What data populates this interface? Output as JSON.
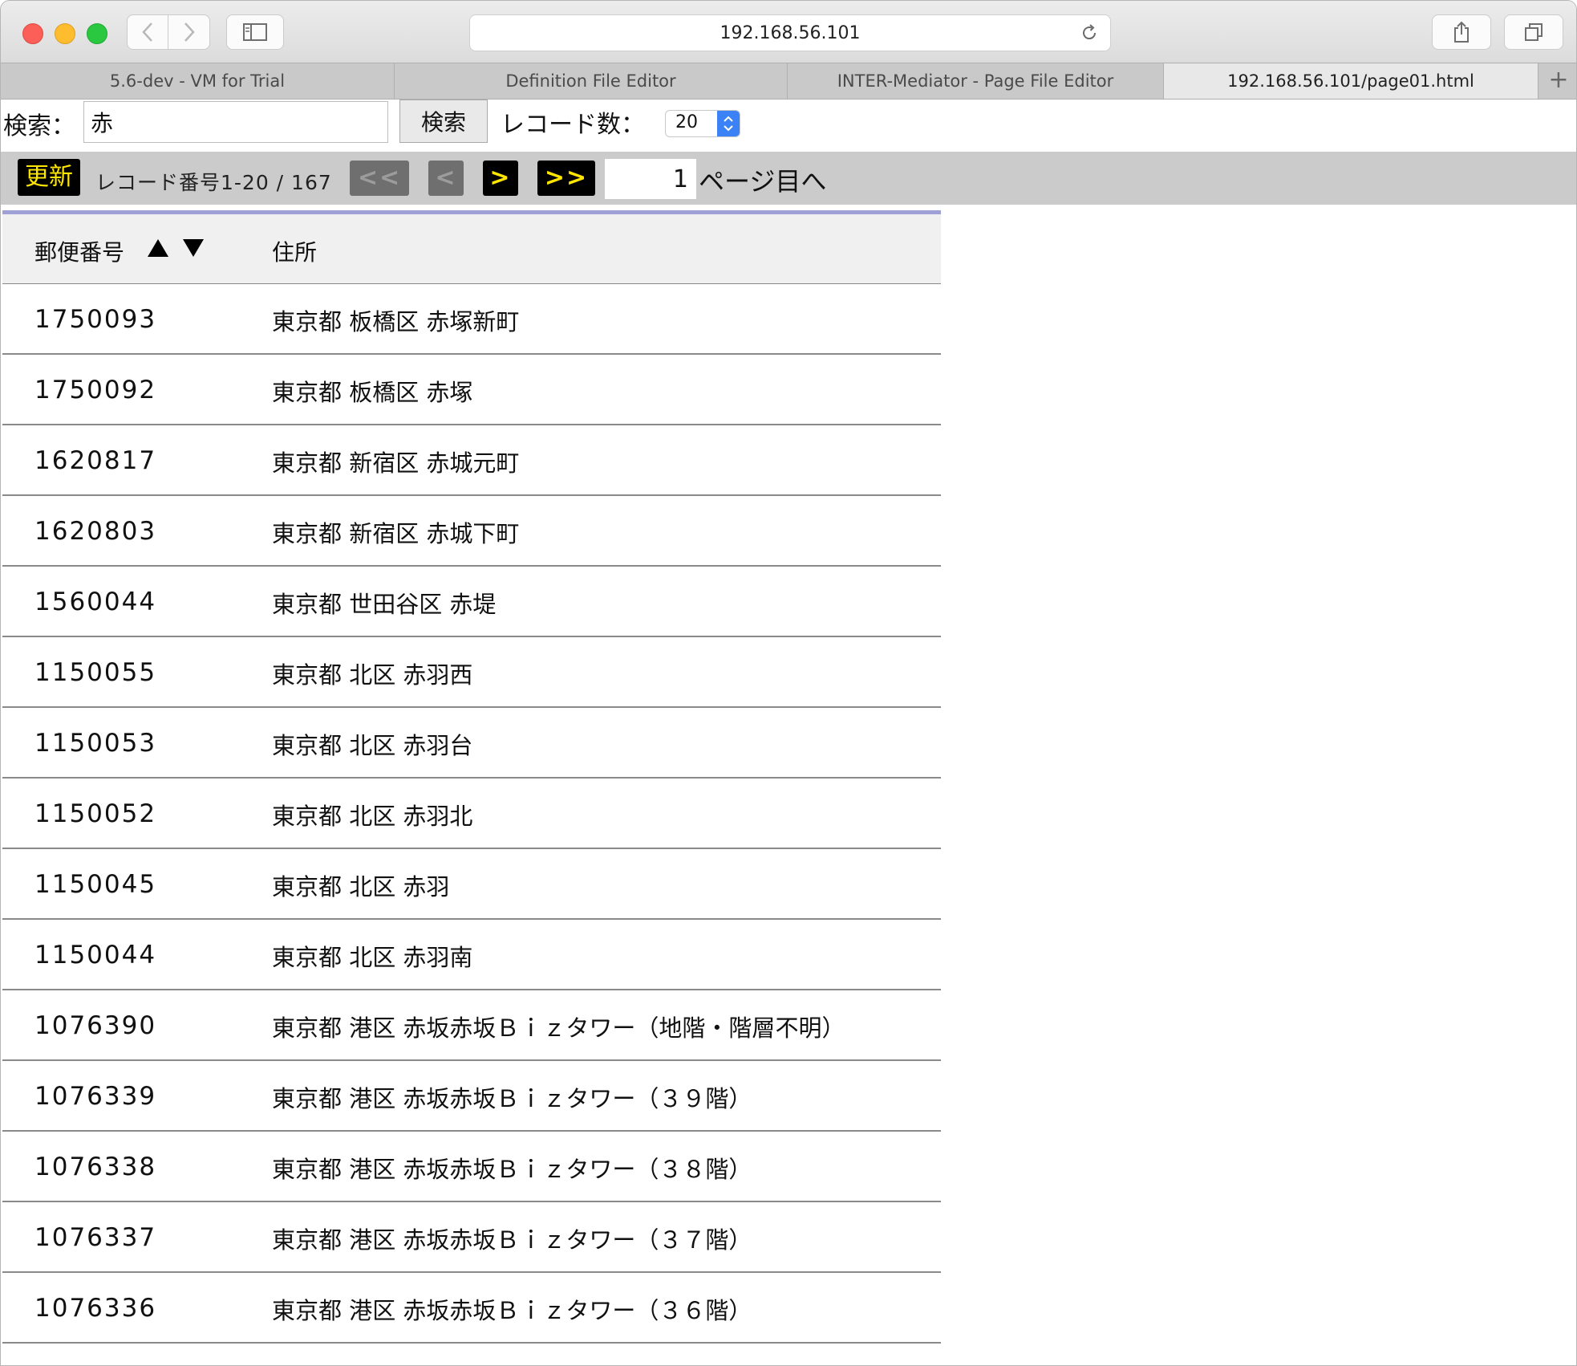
{
  "browser": {
    "url": "192.168.56.101",
    "tabs": [
      {
        "label": "5.6-dev - VM for Trial"
      },
      {
        "label": "Definition File Editor"
      },
      {
        "label": "INTER-Mediator - Page File Editor"
      },
      {
        "label": "192.168.56.101/page01.html"
      }
    ],
    "new_tab_glyph": "+"
  },
  "search": {
    "label": "検索：",
    "value": "赤",
    "button_label": "検索",
    "count_label": "レコード数：",
    "count_value": "20"
  },
  "pager": {
    "update_label": "更新",
    "record_info": "レコード番号1-20 / 167",
    "first_label": "<<",
    "prev_label": "<",
    "next_label": ">",
    "last_label": ">>",
    "page_value": "1",
    "page_suffix": "ページ目へ"
  },
  "table": {
    "headers": {
      "zip": "郵便番号",
      "address": "住所"
    },
    "rows": [
      {
        "zip": "1750093",
        "address": "東京都 板橋区 赤塚新町"
      },
      {
        "zip": "1750092",
        "address": "東京都 板橋区 赤塚"
      },
      {
        "zip": "1620817",
        "address": "東京都 新宿区 赤城元町"
      },
      {
        "zip": "1620803",
        "address": "東京都 新宿区 赤城下町"
      },
      {
        "zip": "1560044",
        "address": "東京都 世田谷区 赤堤"
      },
      {
        "zip": "1150055",
        "address": "東京都 北区 赤羽西"
      },
      {
        "zip": "1150053",
        "address": "東京都 北区 赤羽台"
      },
      {
        "zip": "1150052",
        "address": "東京都 北区 赤羽北"
      },
      {
        "zip": "1150045",
        "address": "東京都 北区 赤羽"
      },
      {
        "zip": "1150044",
        "address": "東京都 北区 赤羽南"
      },
      {
        "zip": "1076390",
        "address": "東京都 港区 赤坂赤坂Ｂｉｚタワー（地階・階層不明）"
      },
      {
        "zip": "1076339",
        "address": "東京都 港区 赤坂赤坂Ｂｉｚタワー（３９階）"
      },
      {
        "zip": "1076338",
        "address": "東京都 港区 赤坂赤坂Ｂｉｚタワー（３８階）"
      },
      {
        "zip": "1076337",
        "address": "東京都 港区 赤坂赤坂Ｂｉｚタワー（３７階）"
      },
      {
        "zip": "1076336",
        "address": "東京都 港区 赤坂赤坂Ｂｉｚタワー（３６階）"
      }
    ]
  },
  "colors": {
    "accent_yellow": "#ffe600",
    "header_rule": "#9ea0d6",
    "pager_bg": "#cbcbcb"
  },
  "icons": {
    "back": "chevron-left-icon",
    "forward": "chevron-right-icon",
    "sidebar": "sidebar-icon",
    "reload": "reload-icon",
    "share": "share-icon",
    "tabs": "tabs-overview-icon",
    "sort_asc": "sort-asc-icon",
    "sort_desc": "sort-desc-icon",
    "select_stepper": "stepper-icon"
  }
}
